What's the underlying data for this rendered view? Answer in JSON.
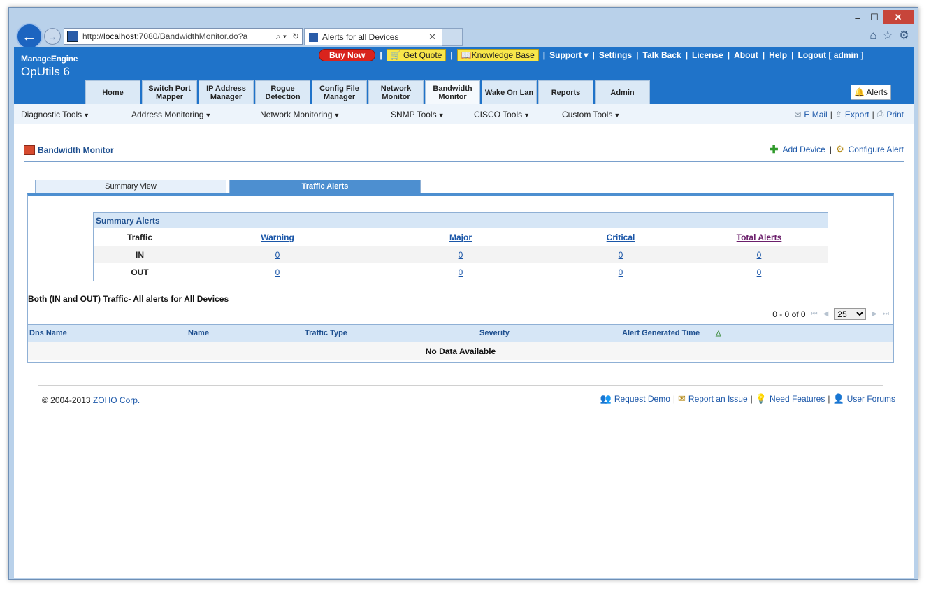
{
  "browser": {
    "address_url_prefix": "http://",
    "address_url_host": "localhost",
    "address_url_rest": ":7080/BandwidthMonitor.do?a",
    "tab_title": "Alerts for all Devices"
  },
  "app": {
    "logo_brand": "ManageEngine",
    "logo_product": "OpUtils 6",
    "top_links": {
      "buy_now": "Buy Now",
      "get_quote": "Get Quote",
      "knowledge_base": "Knowledge Base",
      "support": "Support",
      "settings": "Settings",
      "talk_back": "Talk Back",
      "license": "License",
      "about": "About",
      "help": "Help",
      "logout": "Logout [ admin ]"
    },
    "nav_tabs": [
      {
        "label": "Home"
      },
      {
        "label": "Switch Port Mapper"
      },
      {
        "label": "IP Address Manager"
      },
      {
        "label": "Rogue Detection"
      },
      {
        "label": "Config File Manager"
      },
      {
        "label": "Network Monitor"
      },
      {
        "label": "Bandwidth Monitor"
      },
      {
        "label": "Wake On Lan"
      },
      {
        "label": "Reports"
      },
      {
        "label": "Admin"
      }
    ],
    "alerts_button": "Alerts",
    "submenu": {
      "diagnostic": "Diagnostic Tools",
      "address": "Address Monitoring",
      "network": "Network Monitoring",
      "snmp": "SNMP Tools",
      "cisco": "CISCO Tools",
      "custom": "Custom Tools",
      "email": "E Mail",
      "export": "Export",
      "print": "Print"
    }
  },
  "page": {
    "title": "Bandwidth Monitor",
    "add_device": "Add Device",
    "configure_alert": "Configure Alert",
    "view_tabs": {
      "summary": "Summary View",
      "traffic": "Traffic Alerts"
    },
    "summary": {
      "heading": "Summary Alerts",
      "col_traffic": "Traffic",
      "col_warning": "Warning",
      "col_major": "Major",
      "col_critical": "Critical",
      "col_total": "Total Alerts",
      "rows": [
        {
          "label": "IN",
          "warning": "0",
          "major": "0",
          "critical": "0",
          "total": "0"
        },
        {
          "label": "OUT",
          "warning": "0",
          "major": "0",
          "critical": "0",
          "total": "0"
        }
      ]
    },
    "both_title": "Both (IN and OUT) Traffic- All alerts for All Devices",
    "pager": {
      "range": "0 - 0 of 0",
      "page_size": "25"
    },
    "grid": {
      "headers": {
        "dns": "Dns Name",
        "name": "Name",
        "type": "Traffic Type",
        "severity": "Severity",
        "time": "Alert Generated Time"
      },
      "empty": "No Data Available"
    }
  },
  "footer": {
    "copyright": "© 2004-2013",
    "company": "ZOHO Corp.",
    "request_demo": "Request Demo",
    "report_issue": "Report an Issue",
    "need_features": "Need Features",
    "user_forums": "User Forums"
  },
  "colors": {
    "header_blue": "#1f73c9",
    "tab_active_blue": "#4d8fd0",
    "link_blue": "#1a56a8",
    "buy_now_red": "#d9231d",
    "highlight_yellow": "#f8e64a"
  }
}
